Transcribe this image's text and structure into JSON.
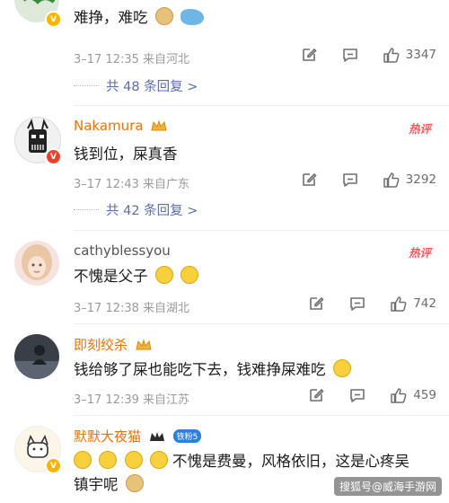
{
  "comments": [
    {
      "text": "难挣，难吃",
      "meta": "3–17 12:35 来自河北",
      "likes": "3347",
      "replies": "共 48 条回复 >"
    },
    {
      "name": "Nakamura",
      "text": "钱到位，屎真香",
      "meta": "3–17 12:43 来自广东",
      "likes": "3292",
      "replies": "共 42 条回复 >",
      "hot_label": "热评"
    },
    {
      "name": "cathyblessyou",
      "text": "不愧是父子",
      "meta": "3–17 12:38 来自湖北",
      "likes": "742",
      "hot_label": "热评"
    },
    {
      "name": "即刻绞杀",
      "text": "钱给够了屎也能吃下去，钱难挣屎难吃",
      "meta": "3–17 12:39 来自江苏",
      "likes": "459"
    },
    {
      "name": "默默大夜猫",
      "fan_badge": "铁粉5",
      "text_line1": "不愧是费曼，风格依旧，这是心疼吴",
      "text_line2": "镇宇呢"
    }
  ],
  "icon_names": [
    "edit-icon",
    "comment-icon",
    "like-icon",
    "doge-emoji",
    "whale-emoji",
    "laugh-cry-emoji",
    "grin-emoji",
    "crown-icon"
  ],
  "colors": {
    "username_orange": "#e8730c",
    "reply_link": "#5b6ea8",
    "hot": "#f25c5c",
    "meta": "#9a9a9a"
  },
  "watermark": "搜狐号@威海手游网"
}
